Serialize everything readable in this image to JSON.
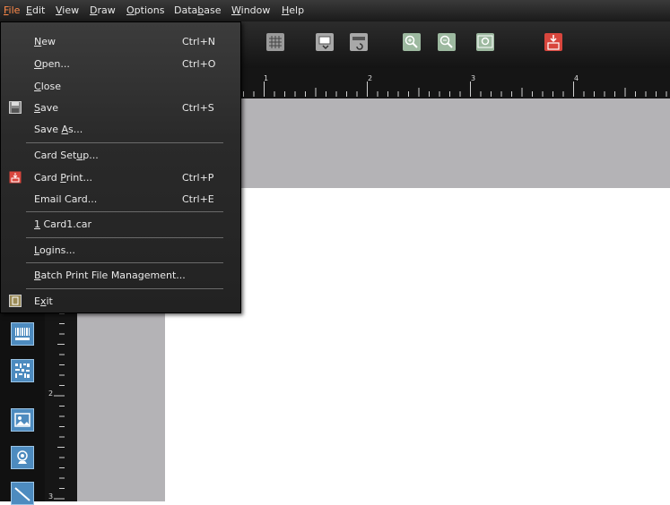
{
  "menubar": {
    "items": [
      {
        "label": "File",
        "mn": "F",
        "rest": "ile"
      },
      {
        "label": "Edit",
        "mn": "E",
        "rest": "dit"
      },
      {
        "label": "View",
        "mn": "V",
        "rest": "iew"
      },
      {
        "label": "Draw",
        "mn": "D",
        "rest": "raw"
      },
      {
        "label": "Options",
        "mn": "O",
        "rest": "ptions"
      },
      {
        "label": "Database",
        "pre": "Data",
        "mn": "b",
        "rest": "ase"
      },
      {
        "label": "Window",
        "mn": "W",
        "rest": "indow"
      },
      {
        "label": "Help",
        "mn": "H",
        "rest": "elp"
      }
    ]
  },
  "file_menu": {
    "new": {
      "mn": "N",
      "rest": "ew",
      "shortcut": "Ctrl+N"
    },
    "open": {
      "mn": "O",
      "rest": "pen...",
      "shortcut": "Ctrl+O"
    },
    "close": {
      "mn": "C",
      "rest": "lose"
    },
    "save": {
      "mn": "S",
      "rest": "ave",
      "shortcut": "Ctrl+S"
    },
    "save_as": {
      "pre": "Save ",
      "mn": "A",
      "rest": "s..."
    },
    "card_setup": {
      "pre": "Card Set",
      "mn": "u",
      "rest": "p..."
    },
    "card_print": {
      "pre": "Card ",
      "mn": "P",
      "rest": "rint...",
      "shortcut": "Ctrl+P"
    },
    "email_card": {
      "label": "Email Card...",
      "shortcut": "Ctrl+E"
    },
    "recent": {
      "mn": "1",
      "rest": " Card1.car"
    },
    "logins": {
      "mn": "L",
      "rest": "ogins..."
    },
    "batch": {
      "mn": "B",
      "rest": "atch Print File Management..."
    },
    "exit": {
      "pre": "E",
      "mn": "x",
      "rest": "it"
    }
  },
  "ruler": {
    "h_numbers": [
      "1",
      "2",
      "3",
      "4"
    ],
    "v_numbers": [
      "2",
      "3"
    ]
  },
  "colors": {
    "menu_bg": "#2a2a2a",
    "accent": "#ff8a4a",
    "canvas_grey": "#b4b3b6",
    "tool_blue": "#4d8bbf"
  }
}
